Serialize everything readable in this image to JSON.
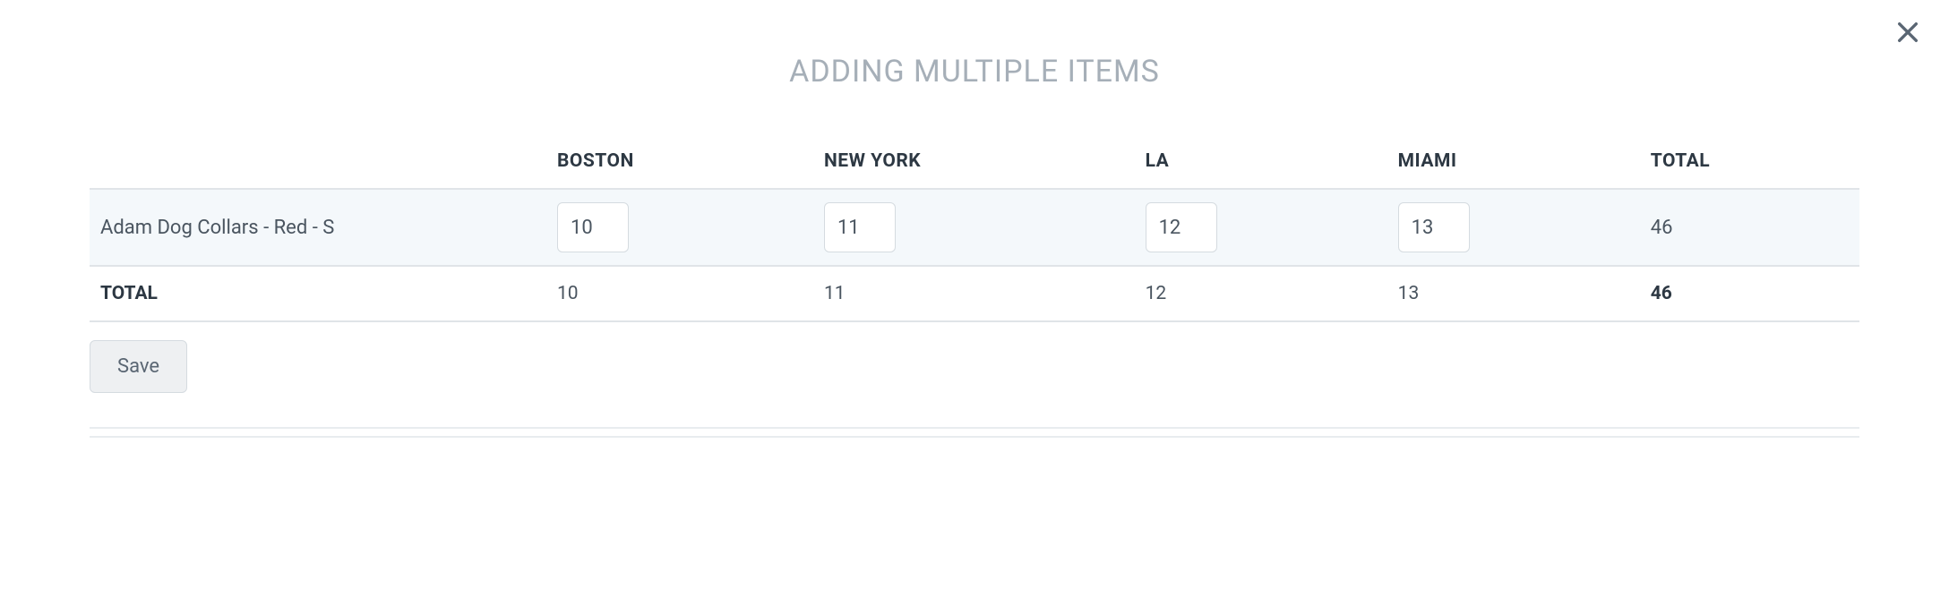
{
  "title": "ADDING MULTIPLE ITEMS",
  "columns": {
    "item": "",
    "c1": "BOSTON",
    "c2": "NEW YORK",
    "c3": "LA",
    "c4": "MIAMI",
    "total": "TOTAL"
  },
  "row": {
    "name": "Adam Dog Collars - Red - S",
    "v1": "10",
    "v2": "11",
    "v3": "12",
    "v4": "13",
    "total": "46"
  },
  "totals": {
    "label": "TOTAL",
    "v1": "10",
    "v2": "11",
    "v3": "12",
    "v4": "13",
    "grand": "46"
  },
  "actions": {
    "save": "Save"
  }
}
